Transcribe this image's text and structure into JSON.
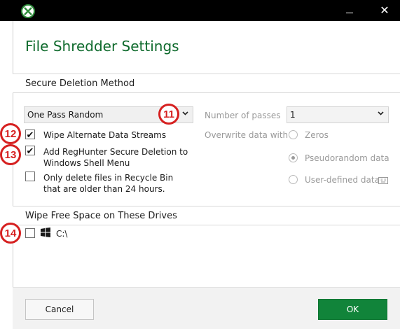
{
  "window": {
    "icon": "reghunter-logo-icon",
    "minimize_symbol": "",
    "close_symbol": "✕"
  },
  "page_title": "File Shredder Settings",
  "secure_deletion": {
    "heading": "Secure Deletion Method",
    "method_select": {
      "value": "One Pass Random",
      "icon": "chevron-down-icon"
    },
    "passes": {
      "label": "Number of passes",
      "value": "1"
    },
    "overwrite": {
      "label": "Overwrite data with",
      "options": [
        {
          "label": "Zeros",
          "selected": false
        },
        {
          "label": "Pseudorandom data",
          "selected": true
        },
        {
          "label": "User-defined data",
          "selected": false
        }
      ]
    },
    "checkboxes": [
      {
        "label": "Wipe Alternate Data Streams",
        "checked": true
      },
      {
        "label": "Add RegHunter Secure Deletion to Windows Shell Menu",
        "checked": true
      },
      {
        "label": "Only delete files in Recycle Bin that are older than 24 hours.",
        "checked": false
      }
    ]
  },
  "wipe_free_space": {
    "heading": "Wipe Free Space on These Drives",
    "drives": [
      {
        "label": "C:\\",
        "checked": false,
        "icon": "windows-icon"
      }
    ]
  },
  "badges": [
    "11",
    "12",
    "13",
    "14"
  ],
  "footer": {
    "cancel_label": "Cancel",
    "ok_label": "OK"
  },
  "colors": {
    "title_green": "#0e6a2c",
    "ok_green": "#11843a",
    "badge_red": "#d62020"
  }
}
